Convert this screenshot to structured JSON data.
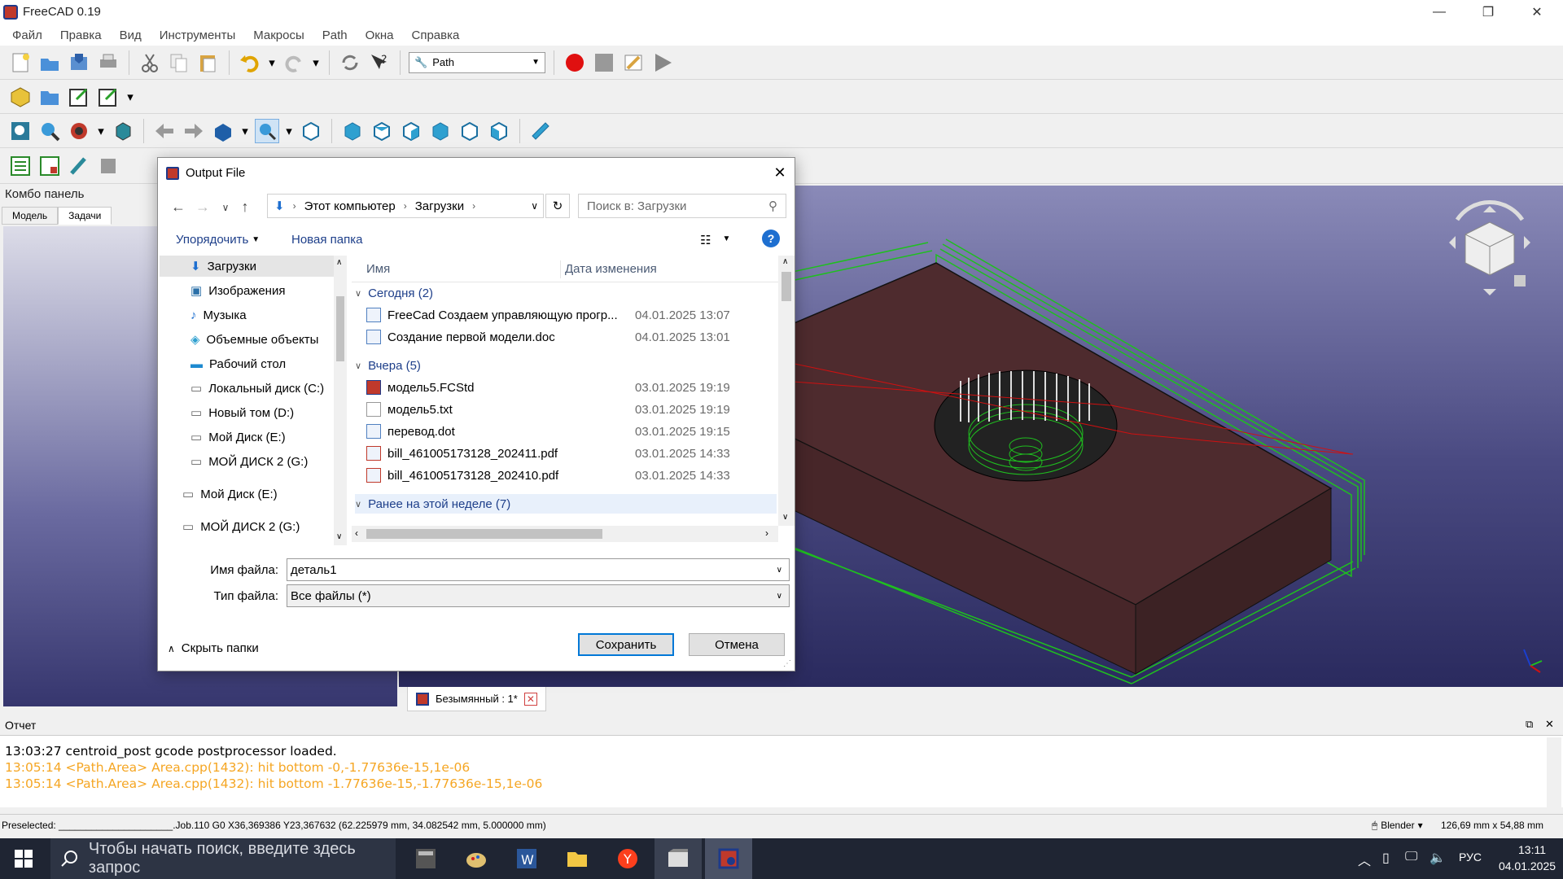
{
  "window": {
    "title": "FreeCAD 0.19"
  },
  "menu": [
    "Файл",
    "Правка",
    "Вид",
    "Инструменты",
    "Макросы",
    "Path",
    "Окна",
    "Справка"
  ],
  "workbench": {
    "selected": "Path"
  },
  "combo_panel": {
    "title": "Комбо панель",
    "tabs": [
      "Модель",
      "Задачи"
    ]
  },
  "document_tab": {
    "label": "Безымянный : 1*"
  },
  "report": {
    "title": "Отчет",
    "lines": [
      {
        "text": "13:03:27  centroid_post gcode postprocessor loaded.",
        "color": "#000000"
      },
      {
        "text": "13:05:14  <Path.Area> Area.cpp(1432): hit bottom -0,-1.77636e-15,1e-06",
        "color": "#f5a623"
      },
      {
        "text": "13:05:14  <Path.Area> Area.cpp(1432): hit bottom -1.77636e-15,-1.77636e-15,1e-06",
        "color": "#f5a623"
      }
    ]
  },
  "statusbar": {
    "preselected": "Preselected: _____________________.Job.110 G0 X36,369386 Y23,367632 (62.225979 mm, 34.082542 mm, 5.000000 mm)",
    "nav_style": "Blender",
    "dimensions": "126,69 mm x 54,88 mm"
  },
  "dialog": {
    "title": "Output File",
    "address": {
      "root": "Этот компьютер",
      "folder": "Загрузки"
    },
    "search_placeholder": "Поиск в: Загрузки",
    "toolbar": {
      "organize": "Упорядочить",
      "new_folder": "Новая папка"
    },
    "nav": [
      {
        "label": "Загрузки",
        "icon": "download-arrow-icon",
        "selected": true
      },
      {
        "label": "Изображения",
        "icon": "pictures-icon"
      },
      {
        "label": "Музыка",
        "icon": "music-note-icon"
      },
      {
        "label": "Объемные объекты",
        "icon": "3d-objects-icon"
      },
      {
        "label": "Рабочий стол",
        "icon": "desktop-icon"
      },
      {
        "label": "Локальный диск (C:)",
        "icon": "drive-icon"
      },
      {
        "label": "Новый том (D:)",
        "icon": "drive-icon"
      },
      {
        "label": "Мой Диск (E:)",
        "icon": "drive-icon"
      },
      {
        "label": "МОЙ ДИСК 2 (G:)",
        "icon": "drive-icon"
      },
      {
        "label": "Мой Диск (E:)",
        "icon": "drive-icon",
        "level": 0
      },
      {
        "label": "МОЙ ДИСК 2 (G:)",
        "icon": "drive-icon",
        "level": 0
      }
    ],
    "columns": {
      "name": "Имя",
      "date": "Дата изменения"
    },
    "groups": [
      {
        "label": "Сегодня (2)",
        "files": [
          {
            "name": "FreeCad Создаем управляющую прогр...",
            "date": "04.01.2025 13:07"
          },
          {
            "name": "Создание первой модели.doc",
            "date": "04.01.2025 13:01"
          }
        ]
      },
      {
        "label": "Вчера (5)",
        "files": [
          {
            "name": "модель5.FCStd",
            "date": "03.01.2025 19:19"
          },
          {
            "name": "модель5.txt",
            "date": "03.01.2025 19:19"
          },
          {
            "name": "перевод.dot",
            "date": "03.01.2025 19:15"
          },
          {
            "name": "bill_461005173128_202411.pdf",
            "date": "03.01.2025 14:33"
          },
          {
            "name": "bill_461005173128_202410.pdf",
            "date": "03.01.2025 14:33"
          }
        ]
      },
      {
        "label": "Ранее на этой неделе (7)",
        "files": []
      }
    ],
    "filename_label": "Имя файла:",
    "filename_value": "деталь1",
    "filetype_label": "Тип файла:",
    "filetype_value": "Все файлы (*)",
    "hide_folders": "Скрыть папки",
    "save": "Сохранить",
    "cancel": "Отмена"
  },
  "taskbar": {
    "search_placeholder": "Чтобы начать поиск, введите здесь запрос",
    "lang": "РУС",
    "time": "13:11",
    "date": "04.01.2025"
  }
}
